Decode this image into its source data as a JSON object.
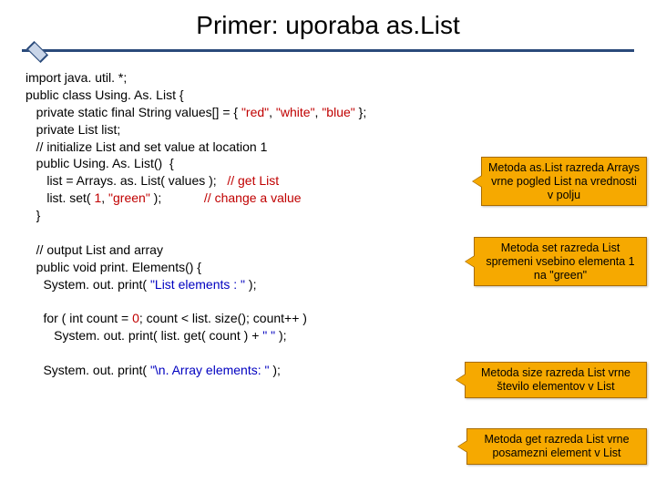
{
  "title": "Primer: uporaba as.List",
  "code": {
    "l1": "import java. util. *;",
    "l2": "public class Using. As. List {",
    "l3a": "   private static final String values[] = { ",
    "l3_red": "\"red\"",
    "l3_sep1": ", ",
    "l3_white": "\"white\"",
    "l3_sep2": ", ",
    "l3_blue": "\"blue\"",
    "l3b": " };",
    "l4": "   private List list;",
    "l5": "   // initialize List and set value at location 1",
    "l6": "   public Using. As. List()  {",
    "l7a": "      list = Arrays. as. List( values );   ",
    "l7c": "// get List",
    "l8a": "      list. set( ",
    "l8n": "1",
    "l8b": ", ",
    "l8s": "\"green\"",
    "l8c": " );            ",
    "l8d": "// change a value",
    "l9": "   }",
    "l11": "   // output List and array",
    "l12": "   public void print. Elements() {",
    "l13a": "     System. out. print( ",
    "l13s": "\"List elements : \"",
    "l13b": " );",
    "l15a": "     for ( int count = ",
    "l15n": "0",
    "l15b": "; count < list. size(); count++ )",
    "l16a": "        System. out. print( list. get( count ) + ",
    "l16s": "\" \"",
    "l16b": " );",
    "l18a": "     System. out. print( ",
    "l18s": "\"\\n. Array elements: \"",
    "l18b": " );"
  },
  "callouts": {
    "c1": "Metoda  as.List razreda Arrays vrne  pogled List na vrednosti v polju",
    "c2": "Metoda set razreda List spremeni vsebino elementa 1 na \"green\"",
    "c3": "Metoda size razreda List vrne število elementov v List",
    "c4": "Metoda get razreda List vrne posamezni  element v List"
  }
}
